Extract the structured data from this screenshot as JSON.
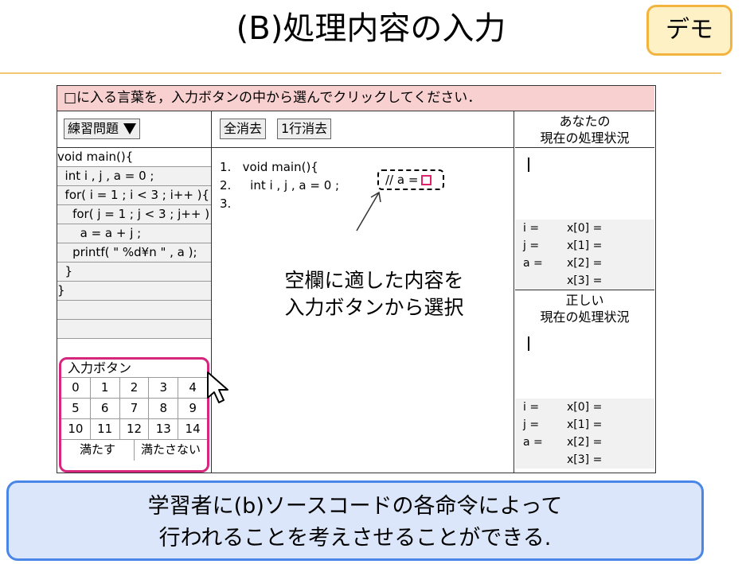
{
  "header": {
    "title": "(B)処理内容の入力",
    "demo_label": "デモ"
  },
  "instruction": "□に入る言葉を，入力ボタンの中から選んでクリックしてください．",
  "problem_selector": {
    "label": "練習問題"
  },
  "code_lines": [
    "void main(){",
    "  int i , j , a = 0 ;",
    "  for( i = 1 ; i < 3 ; i++ ){",
    "    for( j = 1 ; j < 3 ; j++ )",
    "      a = a + j ;",
    "    printf( \" %d¥n \" , a );",
    "  }",
    "}",
    "",
    ""
  ],
  "keypad": {
    "title": "入力ボタン",
    "rows": [
      [
        "0",
        "1",
        "2",
        "3",
        "4"
      ],
      [
        "5",
        "6",
        "7",
        "8",
        "9"
      ],
      [
        "10",
        "11",
        "12",
        "13",
        "14"
      ],
      [
        "満たす",
        "満たさない"
      ]
    ]
  },
  "toolbar": {
    "clear_all": "全消去",
    "clear_line": "1行消去"
  },
  "editor": {
    "lines": [
      "1.   void main(){",
      "2.     int i , j , a = 0 ;",
      "3."
    ],
    "answer_prefix": "// a ="
  },
  "callout": {
    "line1": "空欄に適した内容を",
    "line2": "入力ボタンから選択"
  },
  "your_status": {
    "title_line1": "あなたの",
    "title_line2": "現在の処理状況",
    "vars_left": [
      "i =",
      "j =",
      "a =",
      ""
    ],
    "vars_right": [
      "x[0] =",
      "x[1] =",
      "x[2] =",
      "x[3] ="
    ]
  },
  "correct_status": {
    "title_line1": "正しい",
    "title_line2": "現在の処理状況",
    "vars_left": [
      "i =",
      "j =",
      "a =",
      ""
    ],
    "vars_right": [
      "x[0] =",
      "x[1] =",
      "x[2] =",
      "x[3] ="
    ]
  },
  "summary": {
    "line1": "学習者に(b)ソースコードの各命令によって",
    "line2": "行われることを考えさせることができる."
  },
  "colors": {
    "instruction_bg": "#f8d0d0",
    "keypad_border": "#d6267d",
    "summary_bg": "#dbe6fa",
    "summary_border": "#4a86e8",
    "demo_bg": "#fff1c6",
    "demo_border": "#f3b43f"
  }
}
